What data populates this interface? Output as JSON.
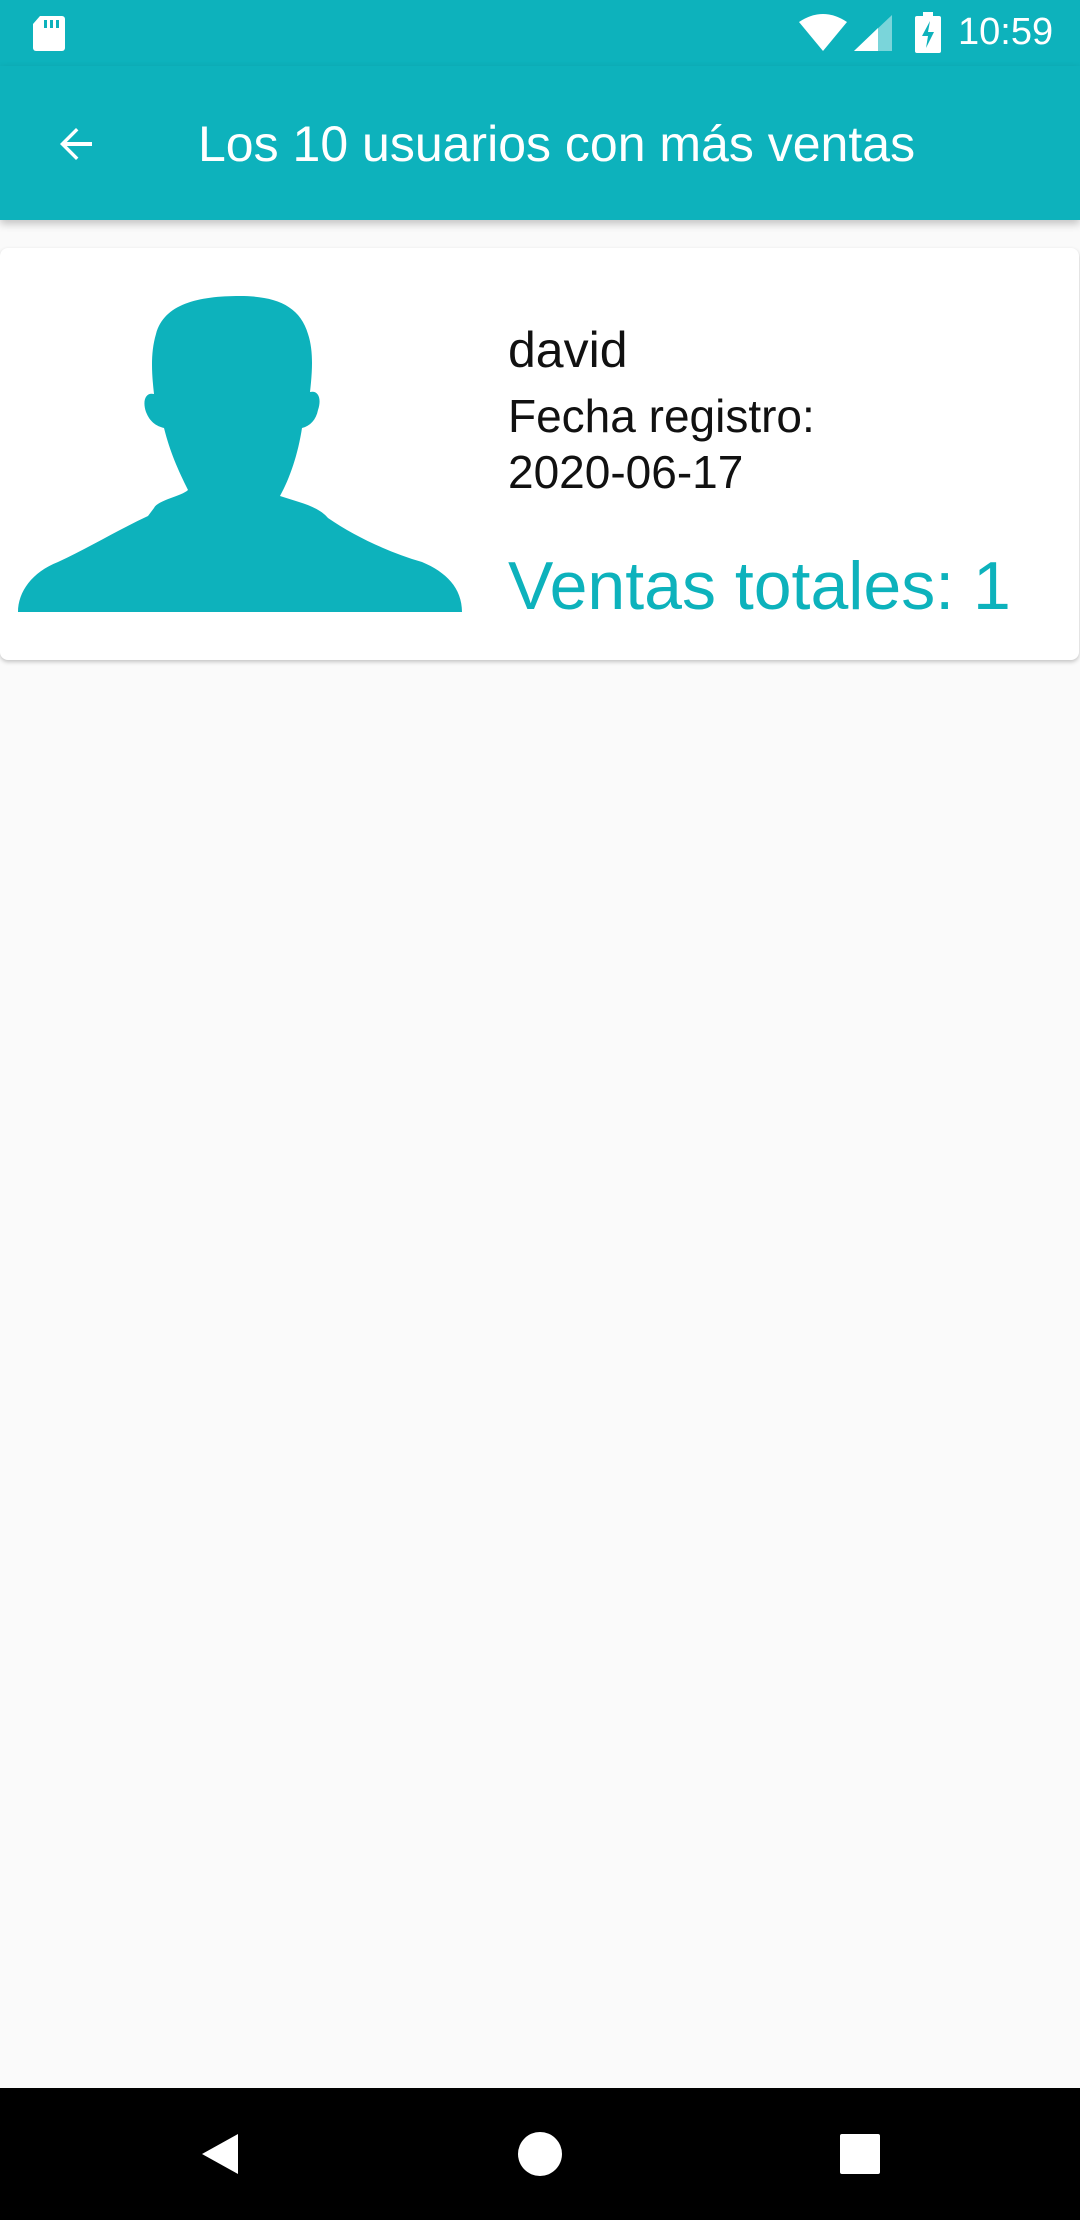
{
  "status_bar": {
    "time": "10:59",
    "icons": [
      "sd-card-icon",
      "wifi-icon",
      "cell-signal-icon",
      "battery-charging-icon"
    ]
  },
  "app_bar": {
    "title": "Los 10 usuarios con más ventas",
    "back_icon": "arrow-back-icon"
  },
  "users": [
    {
      "name": "david",
      "registration_label": "Fecha registro:",
      "registration_date": "2020-06-17",
      "sales_label": "Ventas totales: 1",
      "avatar_icon": "person-silhouette-icon"
    }
  ],
  "nav_bar": {
    "icons": [
      "nav-back-icon",
      "nav-home-icon",
      "nav-recents-icon"
    ]
  },
  "colors": {
    "primary": "#0db2bc",
    "background": "#fafafa",
    "card": "#ffffff",
    "text": "#111111",
    "nav_bar": "#000000"
  }
}
